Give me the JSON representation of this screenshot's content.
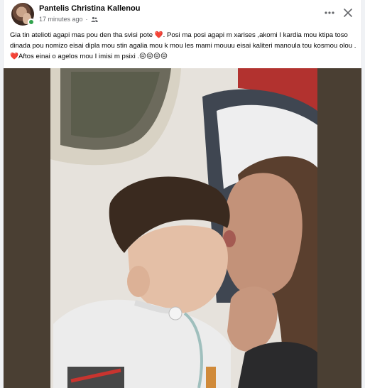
{
  "post": {
    "author": "Pantelis Christina Kallenou",
    "timestamp": "17 minutes ago",
    "separator": "·",
    "audience_icon": "friends-icon",
    "text": "Gia tin atelioti agapi mas pou den tha svisi pote ❤️. Posi ma posi agapi m  xarises ,akomi I kardia mou ktipa toso dinada pou nomizo eisai dipla mou stin agalia mou k mou les mami mouuu eisai kaliteri manoula tou kosmou olou .❤️Aftos einai o agelos mou I imisi m psixi .😔😔😔😔",
    "photo_icon": "photo-image"
  },
  "actions": {
    "more_icon": "more-options-icon",
    "close_icon": "close-icon"
  },
  "colors": {
    "online": "#31a24c",
    "text": "#050505",
    "meta": "#65676b",
    "heart": "#e41e3f"
  }
}
